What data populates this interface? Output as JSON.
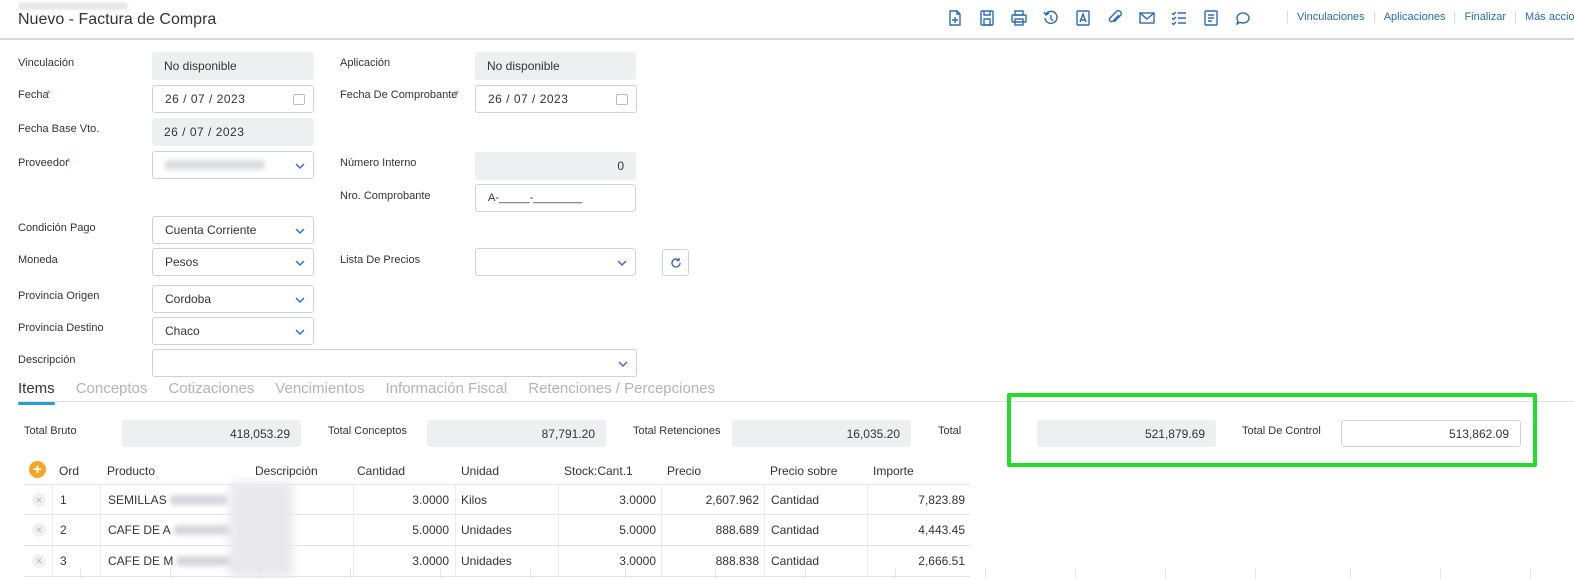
{
  "header": {
    "title": "Nuevo - Factura de Compra",
    "icons": [
      "new-document-icon",
      "save-icon",
      "print-icon",
      "history-icon",
      "pdf-icon",
      "attach-icon",
      "mail-icon",
      "checklist-icon",
      "report-icon",
      "comment-icon"
    ],
    "links": [
      "Vinculaciones",
      "Aplicaciones",
      "Finalizar",
      "Más accio"
    ]
  },
  "form": {
    "vinculacion": {
      "label": "Vinculación",
      "value": "No disponible"
    },
    "aplicacion": {
      "label": "Aplicación",
      "value": "No disponible"
    },
    "fecha": {
      "label": "Fecha",
      "value": "26  /  07  /  2023"
    },
    "fecha_comprobante": {
      "label": "Fecha De Comprobante",
      "value": "26  /  07  /  2023"
    },
    "fecha_base_vto": {
      "label": "Fecha Base Vto.",
      "value": "26  /  07  /  2023"
    },
    "proveedor": {
      "label": "Proveedor"
    },
    "numero_interno": {
      "label": "Número Interno",
      "value": "0"
    },
    "nro_comprobante": {
      "label": "Nro. Comprobante",
      "value": "A-_____-________"
    },
    "condicion_pago": {
      "label": "Condición Pago",
      "value": "Cuenta Corriente"
    },
    "moneda": {
      "label": "Moneda",
      "value": "Pesos"
    },
    "lista_precios": {
      "label": "Lista De Precios",
      "value": ""
    },
    "provincia_origen": {
      "label": "Provincia Origen",
      "value": "Cordoba"
    },
    "provincia_destino": {
      "label": "Provincia Destino",
      "value": "Chaco"
    },
    "descripcion": {
      "label": "Descripción",
      "value": ""
    }
  },
  "tabs": [
    "Items",
    "Conceptos",
    "Cotizaciones",
    "Vencimientos",
    "Información Fiscal",
    "Retenciones / Percepciones"
  ],
  "totals": {
    "total_bruto": {
      "label": "Total Bruto",
      "value": "418,053.29"
    },
    "total_conceptos": {
      "label": "Total Conceptos",
      "value": "87,791.20"
    },
    "total_retenciones": {
      "label": "Total Retenciones",
      "value": "16,035.20"
    },
    "total": {
      "label": "Total",
      "value": "521,879.69"
    },
    "total_control": {
      "label": "Total De Control",
      "value": "513,862.09"
    }
  },
  "grid": {
    "add_label": "+",
    "columns": [
      "Ord",
      "Producto",
      "Descripción",
      "Cantidad",
      "Unidad",
      "Stock:Cant.1",
      "Precio",
      "Precio sobre",
      "Importe"
    ],
    "rows": [
      {
        "ord": "1",
        "producto": "SEMILLAS",
        "cantidad": "3.0000",
        "unidad": "Kilos",
        "stock": "3.0000",
        "precio": "2,607.962",
        "precio_sobre": "Cantidad",
        "importe": "7,823.89"
      },
      {
        "ord": "2",
        "producto": "CAFE DE A",
        "cantidad": "5.0000",
        "unidad": "Unidades",
        "stock": "5.0000",
        "precio": "888.689",
        "precio_sobre": "Cantidad",
        "importe": "4,443.45"
      },
      {
        "ord": "3",
        "producto": "CAFE DE M",
        "cantidad": "3.0000",
        "unidad": "Unidades",
        "stock": "3.0000",
        "precio": "888.838",
        "precio_sobre": "Cantidad",
        "importe": "2,666.51"
      }
    ]
  },
  "colors": {
    "accent": "#2b6cb0",
    "tab_underline": "#2b9bd6",
    "highlight": "#22dd2a",
    "add_button": "#f5a623"
  }
}
